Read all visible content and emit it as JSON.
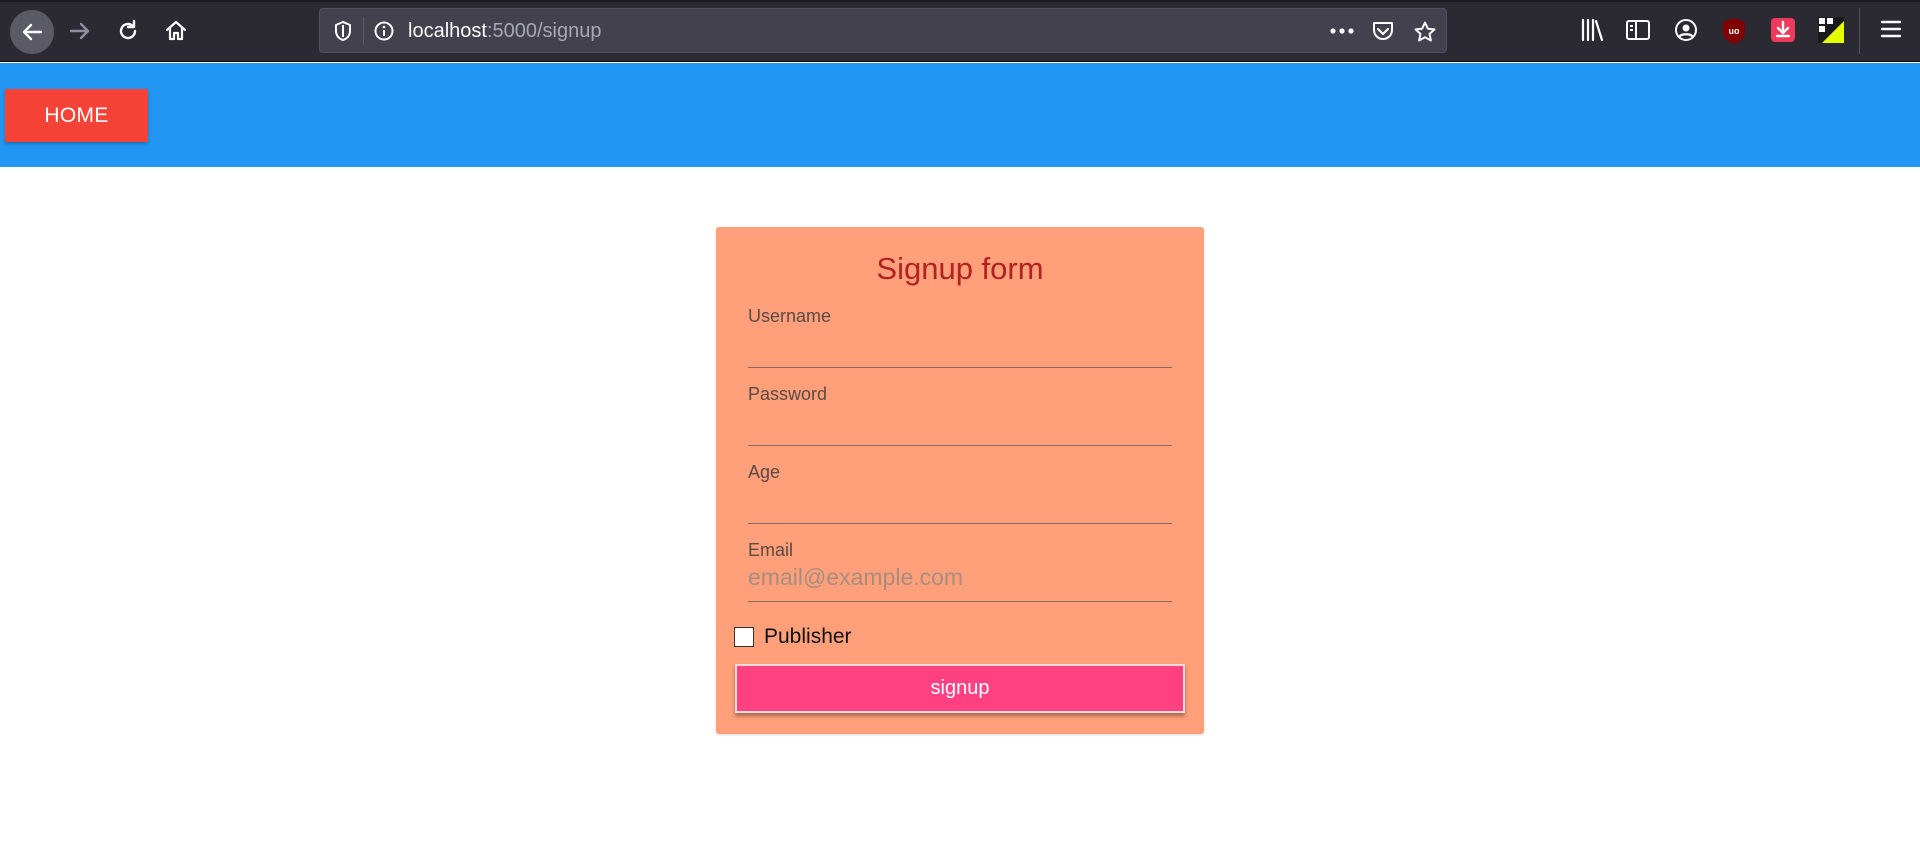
{
  "browser": {
    "url_host": "localhost",
    "url_path": ":5000/signup",
    "icons": [
      "back-icon",
      "forward-icon",
      "reload-icon",
      "home-icon",
      "tracking-shield-icon",
      "site-info-icon",
      "page-actions-icon",
      "pocket-icon",
      "bookmark-star-icon",
      "library-icon",
      "sidebar-icon",
      "account-icon",
      "ublock-icon",
      "download-extension-icon",
      "color-extension-icon",
      "hamburger-menu-icon"
    ]
  },
  "header": {
    "home_label": "HOME",
    "background_color": "#2196f3",
    "home_color": "#f44336"
  },
  "form": {
    "title": "Signup form",
    "fields": [
      {
        "label": "Username",
        "value": "",
        "placeholder": ""
      },
      {
        "label": "Password",
        "value": "",
        "placeholder": ""
      },
      {
        "label": "Age",
        "value": "",
        "placeholder": ""
      },
      {
        "label": "Email",
        "value": "",
        "placeholder": "email@example.com"
      }
    ],
    "publisher_label": "Publisher",
    "publisher_checked": false,
    "submit_label": "signup",
    "card_color": "#ffa07a",
    "title_color": "#b22222",
    "submit_color": "#ff4081"
  }
}
